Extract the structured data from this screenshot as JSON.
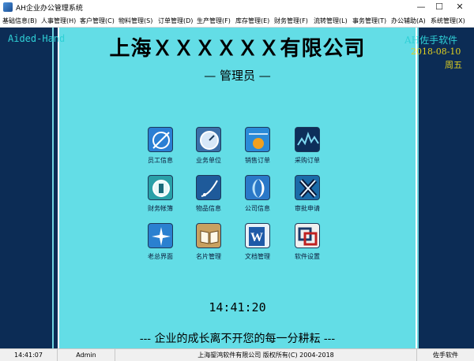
{
  "window": {
    "title": "AH企业办公管理系统",
    "minimize_glyph": "—",
    "maximize_glyph": "☐",
    "close_glyph": "✕"
  },
  "menu": [
    {
      "label": "基础信息(B)"
    },
    {
      "label": "人事管理(H)"
    },
    {
      "label": "客户管理(C)"
    },
    {
      "label": "物料管理(S)"
    },
    {
      "label": "订单管理(D)"
    },
    {
      "label": "生产管理(F)"
    },
    {
      "label": "库存管理(E)"
    },
    {
      "label": "财务管理(F)"
    },
    {
      "label": "流转管理(L)"
    },
    {
      "label": "事务管理(T)"
    },
    {
      "label": "办公辅助(A)"
    },
    {
      "label": "系统管理(X)"
    }
  ],
  "left_panel": {
    "text": "Aided-Hand"
  },
  "right_panel": {
    "brand": "AH佐手软件",
    "date": "2018-08-10",
    "weekday": "周五"
  },
  "header": {
    "company": "上海ＸＸＸＸＸＸ有限公司",
    "role": "— 管理员 —"
  },
  "tiles": [
    {
      "label": "员工信息",
      "icon": "employee-icon",
      "color": "#2a7fd4"
    },
    {
      "label": "业务单位",
      "icon": "business-unit-icon",
      "color": "#3b6fa8"
    },
    {
      "label": "销售订单",
      "icon": "sales-order-icon",
      "color": "#2a8ad8"
    },
    {
      "label": "采购订单",
      "icon": "purchase-order-icon",
      "color": "#0d2e5a"
    },
    {
      "label": "财务帐簿",
      "icon": "ledger-icon",
      "color": "#2aa0a8"
    },
    {
      "label": "物品信息",
      "icon": "goods-icon",
      "color": "#1e5a9a"
    },
    {
      "label": "公司信息",
      "icon": "company-icon",
      "color": "#2a78c8"
    },
    {
      "label": "审批申请",
      "icon": "approval-icon",
      "color": "#1a6aa8"
    },
    {
      "label": "老总界面",
      "icon": "boss-icon",
      "color": "#2a80d0"
    },
    {
      "label": "名片管理",
      "icon": "card-icon",
      "color": "#6a4a20"
    },
    {
      "label": "文档管理",
      "icon": "document-icon",
      "color": "#1e5aa8"
    },
    {
      "label": "软件设置",
      "icon": "settings-icon",
      "color": "#1a3a6a"
    }
  ],
  "clock": {
    "time": "14:41:20"
  },
  "slogan": "--- 企业的成长离不开您的每一分耕耘 ---",
  "status": {
    "time": "14:41:07",
    "user": "Admin",
    "copyright": "上海鋆鸿软件有限公司 版权所有(C) 2004-2018",
    "brand": "佐手软件"
  }
}
